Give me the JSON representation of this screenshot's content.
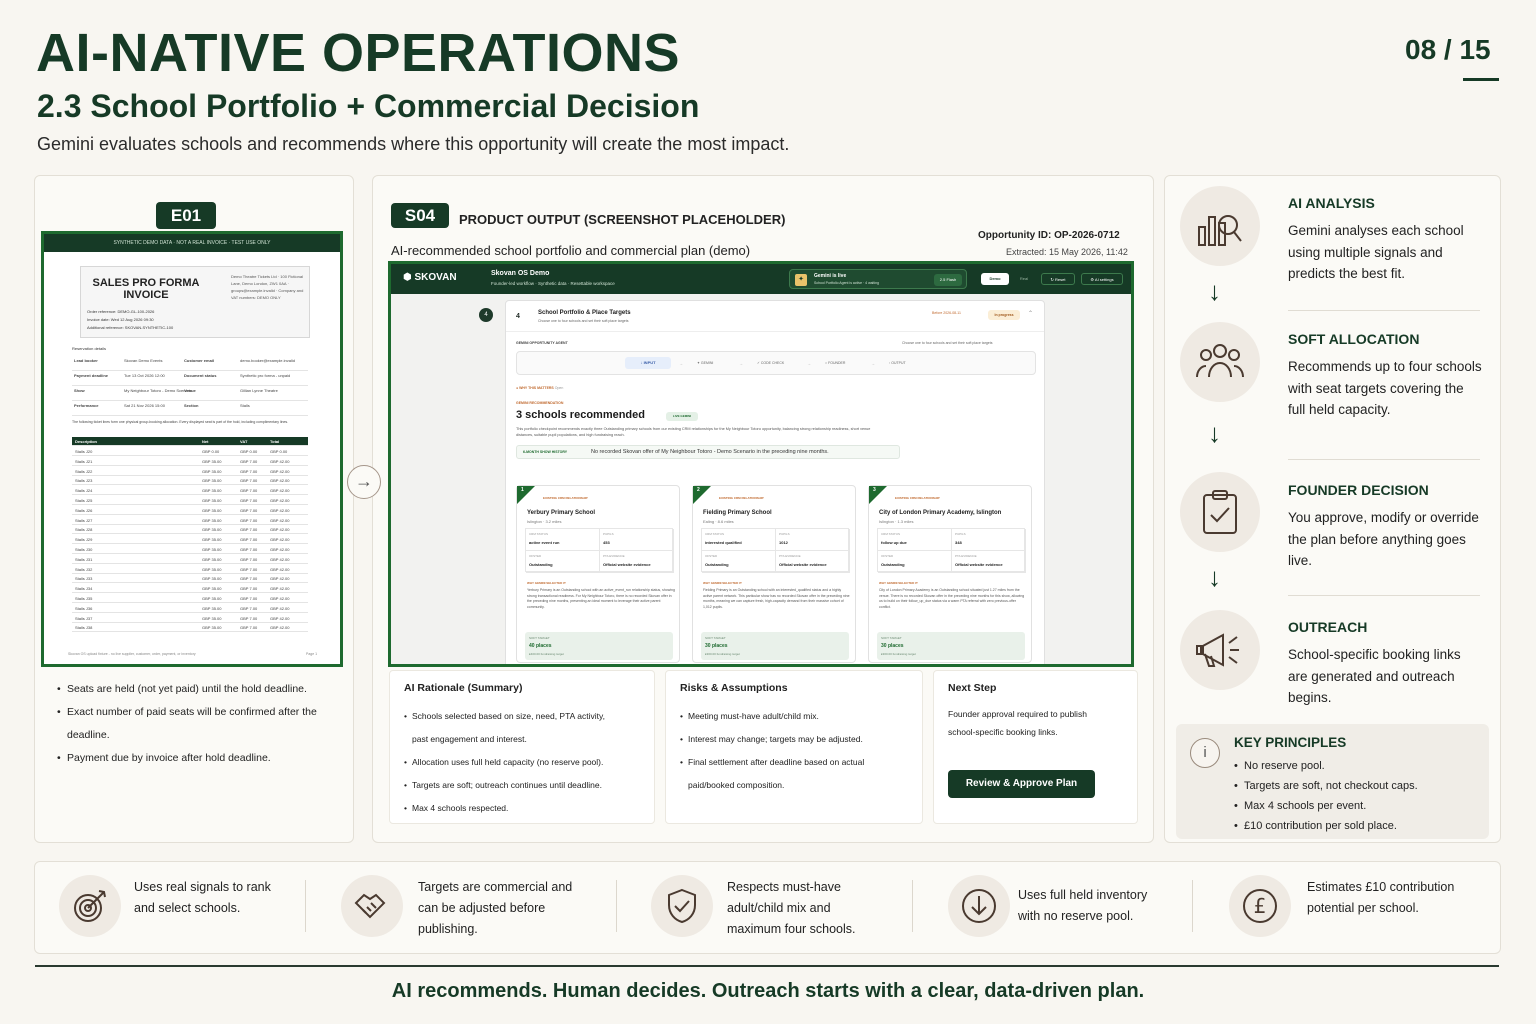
{
  "header": {
    "title": "AI-NATIVE OPERATIONS",
    "subtitle": "2.3 School Portfolio + Commercial Decision",
    "lead": "Gemini evaluates schools and recommends where this opportunity will create the most impact.",
    "page": "08 / 15"
  },
  "left_panel": {
    "tag": "E01",
    "invoice": {
      "band": "SYNTHETIC DEMO DATA · NOT A REAL INVOICE · TEST USE ONLY",
      "title": "SALES PRO FORMA INVOICE",
      "company": "Demo Theatre Tickets Ltd · 100 Fictional Lane, Demo London, ZW1 0AA · groups@example.invalid · Company and VAT numbers: DEMO ONLY",
      "meta": [
        "Order reference: DEMO-GL-100-2026",
        "Invoice date: Wed 12 Aug 2026 09:30",
        "Additional reference: SKOVAN-SYNTHETIC-100"
      ],
      "section": "Reservation details",
      "details": [
        [
          "Lead booker",
          "Skovan Demo Events",
          "Customer email",
          "demo.booker@example.invalid"
        ],
        [
          "Payment deadline",
          "Tue 13 Oct 2026 12:00",
          "Document status",
          "Synthetic pro forma - unpaid"
        ],
        [
          "Show",
          "My Neighbour Totoro - Demo Scenario",
          "Venue",
          "Gillian Lynne Theatre"
        ],
        [
          "Performance",
          "Sat 21 Nov 2026 15:00",
          "Section",
          "Stalls"
        ]
      ],
      "note": "The following ticket lines form one physical group-booking allocation. Every displayed seat is part of the hold, including complimentary lines.",
      "table_headers": [
        "Description",
        "Net",
        "VAT",
        "Total"
      ],
      "rows": [
        [
          "Stalls J20",
          "GBP 0.00",
          "GBP 0.00",
          "GBP 0.00"
        ],
        [
          "Stalls J21",
          "GBP 35.00",
          "GBP 7.00",
          "GBP 42.00"
        ],
        [
          "Stalls J22",
          "GBP 35.00",
          "GBP 7.00",
          "GBP 42.00"
        ],
        [
          "Stalls J23",
          "GBP 35.00",
          "GBP 7.00",
          "GBP 42.00"
        ],
        [
          "Stalls J24",
          "GBP 35.00",
          "GBP 7.00",
          "GBP 42.00"
        ],
        [
          "Stalls J25",
          "GBP 35.00",
          "GBP 7.00",
          "GBP 42.00"
        ],
        [
          "Stalls J26",
          "GBP 35.00",
          "GBP 7.00",
          "GBP 42.00"
        ],
        [
          "Stalls J27",
          "GBP 35.00",
          "GBP 7.00",
          "GBP 42.00"
        ],
        [
          "Stalls J28",
          "GBP 35.00",
          "GBP 7.00",
          "GBP 42.00"
        ],
        [
          "Stalls J29",
          "GBP 35.00",
          "GBP 7.00",
          "GBP 42.00"
        ],
        [
          "Stalls J30",
          "GBP 35.00",
          "GBP 7.00",
          "GBP 42.00"
        ],
        [
          "Stalls J31",
          "GBP 35.00",
          "GBP 7.00",
          "GBP 42.00"
        ],
        [
          "Stalls J32",
          "GBP 35.00",
          "GBP 7.00",
          "GBP 42.00"
        ],
        [
          "Stalls J33",
          "GBP 35.00",
          "GBP 7.00",
          "GBP 42.00"
        ],
        [
          "Stalls J34",
          "GBP 35.00",
          "GBP 7.00",
          "GBP 42.00"
        ],
        [
          "Stalls J35",
          "GBP 35.00",
          "GBP 7.00",
          "GBP 42.00"
        ],
        [
          "Stalls J36",
          "GBP 35.00",
          "GBP 7.00",
          "GBP 42.00"
        ],
        [
          "Stalls J37",
          "GBP 35.00",
          "GBP 7.00",
          "GBP 42.00"
        ],
        [
          "Stalls J38",
          "GBP 35.00",
          "GBP 7.00",
          "GBP 42.00"
        ]
      ],
      "footer": "Skovan OS upload fixture - no live supplier, customer, order, payment, or inventory",
      "page": "Page 1"
    },
    "bullets": [
      "Seats are held (not yet paid) until the hold deadline.",
      "Exact number of paid seats will be confirmed after the deadline.",
      "Payment due by invoice after hold deadline."
    ]
  },
  "mid_panel": {
    "tag": "S04",
    "label": "PRODUCT OUTPUT (SCREENSHOT PLACEHOLDER)",
    "opportunity_id": "Opportunity ID: OP-2026-0712",
    "extracted": "Extracted: 15 May 2026, 11:42",
    "subtitle": "AI-recommended school portfolio and commercial plan (demo)",
    "app": {
      "logo": "SKOVAN",
      "name": "Skovan OS Demo",
      "name_sub": "Founder-led workflow · Synthetic data · Resettable workspace",
      "live_title": "Gemini is live",
      "live_sub": "School Portfolio Agent is active · 4 waiting",
      "model": "2.5 Flash",
      "mode_demo": "Demo",
      "mode_real": "Real",
      "reset": "↻ Reset",
      "settings": "⚙ AI settings",
      "step_num": "4",
      "step_title": "School Portfolio & Place Targets",
      "step_sub": "Choose one to four schools and set their soft place targets",
      "before": "Before 2026-08-11",
      "status": "In progress",
      "agent_label": "GEMINI OPPORTUNITY AGENT",
      "agent_hint": "Choose one to four schools and set their soft place targets",
      "pipeline": [
        "INPUT",
        "GEMINI",
        "CODE CHECK",
        "FOUNDER",
        "OUTPUT"
      ],
      "why_matters": "WHY THIS MATTERS",
      "open": "Open",
      "reco_label": "GEMINI RECOMMENDATION",
      "reco_title": "3 schools recommended",
      "live_badge": "LIVE GEMINI",
      "reco_text": "This portfolio checkpoint recommends exactly three Outstanding primary schools from our existing CRM relationships for the My Neighbour Totoro opportunity, balancing strong relationship readiness, short venue distances, suitable pupil populations, and high fundraising reach.",
      "history_label": "6-MONTH SHOW HISTORY",
      "history_text": "No recorded Skovan offer of My Neighbour Totoro - Demo Scenario in the preceding nine months.",
      "cards": [
        {
          "n": "1",
          "badge": "EXISTING CRM RELATIONSHIP",
          "school": "Yerbury Primary School",
          "loc": "Islington · 3.2 miles",
          "crm": "active event run",
          "pupils": "453",
          "ofsted": "Outstanding",
          "pta": "Official website evidence",
          "why_label": "WHY GEMINI SELECTED IT",
          "why": "Yerbury Primary is an Outstanding school with an active_event_run relationship status, showing strong transactional readiness. For My Neighbour Totoro, there is no recorded Skovan offer in the preceding nine months, presenting an ideal moment to leverage their active parent community.",
          "target": "40 places",
          "target_sub": "£400.00 fundraising target"
        },
        {
          "n": "2",
          "badge": "EXISTING CRM RELATIONSHIP",
          "school": "Fielding Primary School",
          "loc": "Ealing · 8.6 miles",
          "crm": "interested qualified",
          "pupils": "1012",
          "ofsted": "Outstanding",
          "pta": "Official website evidence",
          "why_label": "WHY GEMINI SELECTED IT",
          "why": "Fielding Primary is an Outstanding school with an interested_qualified status and a highly active parent network. This particular show has no recorded Skovan offer in the preceding nine months, meaning we can capture fresh, high-capacity demand from their massive cohort of 1,012 pupils.",
          "target": "30 places",
          "target_sub": "£300.00 fundraising target"
        },
        {
          "n": "3",
          "badge": "EXISTING CRM RELATIONSHIP",
          "school": "City of London Primary Academy, Islington",
          "loc": "Islington · 1.3 miles",
          "crm": "follow up due",
          "pupils": "348",
          "ofsted": "Outstanding",
          "pta": "Official website evidence",
          "why_label": "WHY GEMINI SELECTED IT",
          "why": "City of London Primary Academy is an Outstanding school situated just 1.27 miles from the venue. There is no recorded Skovan offer in the preceding nine months for this show, allowing us to build on their follow_up_due status via a warm PTA referral with zero previous-offer conflict.",
          "target": "30 places",
          "target_sub": "£300.00 fundraising target"
        }
      ],
      "grid_labels": {
        "crm": "CRM STATUS",
        "pupils": "PUPILS",
        "ofsted": "OFSTED",
        "pta": "PTA EVIDENCE",
        "soft": "SOFT TARGET"
      }
    },
    "rationale": {
      "title": "AI Rationale (Summary)",
      "items": [
        "Schools selected based on size, need, PTA activity,",
        "past engagement and interest.",
        "Allocation uses full held capacity (no reserve pool).",
        "Targets are soft; outreach continues until deadline.",
        "Max 4 schools respected."
      ]
    },
    "risks": {
      "title": "Risks & Assumptions",
      "items": [
        "Meeting must-have adult/child mix.",
        "Interest may change; targets may be adjusted.",
        "Final settlement after deadline based on actual",
        "paid/booked composition."
      ]
    },
    "next_step": {
      "title": "Next Step",
      "text": "Founder approval required to publish school-specific booking links.",
      "button": "Review & Approve Plan"
    }
  },
  "right_panel": {
    "steps": [
      {
        "title": "AI ANALYSIS",
        "text": "Gemini analyses each school using multiple signals and predicts the best fit.",
        "icon": "chart-search-icon"
      },
      {
        "title": "SOFT ALLOCATION",
        "text": "Recommends up to four schools with seat targets covering the full held capacity.",
        "icon": "people-icon"
      },
      {
        "title": "FOUNDER DECISION",
        "text": "You approve, modify or override the plan before anything goes live.",
        "icon": "clipboard-check-icon"
      },
      {
        "title": "OUTREACH",
        "text": "School-specific booking links are generated and outreach begins.",
        "icon": "megaphone-icon"
      }
    ],
    "principles": {
      "icon": "i",
      "title": "KEY PRINCIPLES",
      "items": [
        "No reserve pool.",
        "Targets are soft, not checkout caps.",
        "Max 4 schools per event.",
        "£10 contribution per sold place."
      ]
    }
  },
  "features": [
    {
      "text": "Uses real signals to rank and select schools.",
      "icon": "target-icon"
    },
    {
      "text": "Targets are commercial and can be adjusted before publishing.",
      "icon": "handshake-icon"
    },
    {
      "text": "Respects must-have adult/child mix and maximum four schools.",
      "icon": "shield-check-icon"
    },
    {
      "text": "Uses full held inventory with no reserve pool.",
      "icon": "download-circle-icon"
    },
    {
      "text": "Estimates £10 contribution potential per school.",
      "icon": "pound-icon"
    }
  ],
  "footer": "AI recommends. Human decides. Outreach starts with a clear, data-driven plan.",
  "colors": {
    "brand": "#163a26",
    "accent_border": "#1e6a2f",
    "background": "#f8f6f1"
  }
}
